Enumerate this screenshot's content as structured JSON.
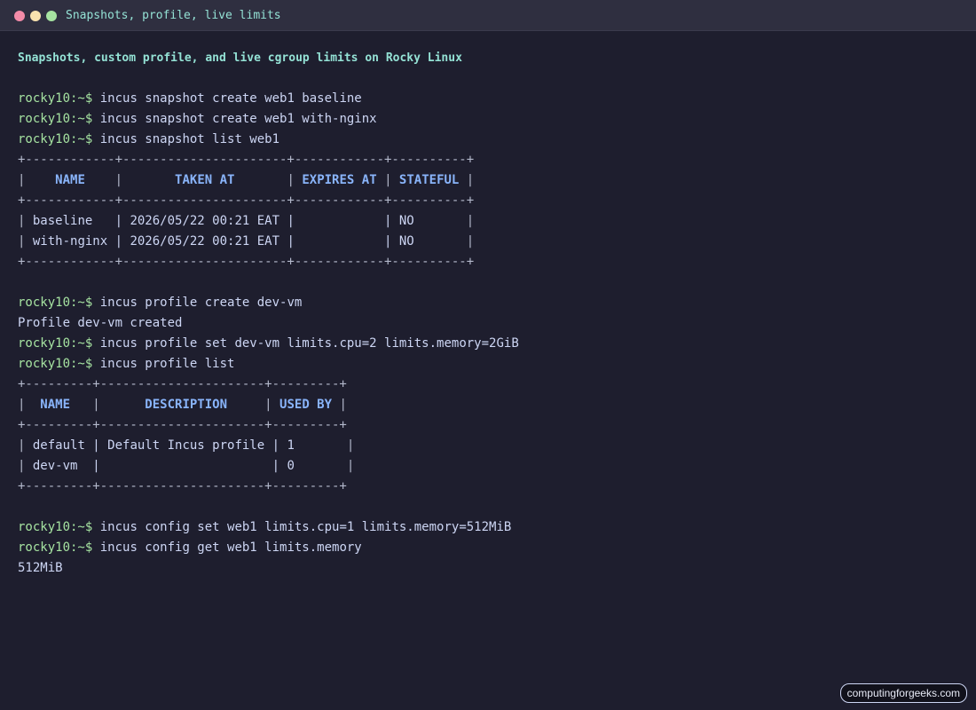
{
  "window": {
    "title": "Snapshots, profile, live limits"
  },
  "colors": {
    "background": "#1e1e2e",
    "titlebar": "#2f2f40",
    "prompt": "#a6e3a1",
    "heading": "#94e2d5",
    "table_header": "#89b4fa",
    "text": "#cdd6f4",
    "close_dot": "#f38ba8",
    "minimize_dot": "#f9e2af",
    "maximize_dot": "#a6e3a1"
  },
  "terminal": {
    "heading": "Snapshots, custom profile, and live cgroup limits on Rocky Linux",
    "prompt": "rocky10:~$",
    "commands": {
      "snap_create_1": "incus snapshot create web1 baseline",
      "snap_create_2": "incus snapshot create web1 with-nginx",
      "snap_list": "incus snapshot list web1",
      "profile_create": "incus profile create dev-vm",
      "profile_set": "incus profile set dev-vm limits.cpu=2 limits.memory=2GiB",
      "profile_list": "incus profile list",
      "config_set": "incus config set web1 limits.cpu=1 limits.memory=512MiB",
      "config_get": "incus config get web1 limits.memory"
    },
    "outputs": {
      "profile_created": "Profile dev-vm created",
      "memory_value": "512MiB"
    },
    "snapshot_table": {
      "border": "+------------+----------------------+------------+----------+",
      "headers": [
        "NAME",
        "TAKEN AT",
        "EXPIRES AT",
        "STATEFUL"
      ],
      "header_cells": [
        "    NAME    ",
        "       TAKEN AT       ",
        " EXPIRES AT ",
        " STATEFUL "
      ],
      "rows": [
        " baseline   | 2026/05/22 00:21 EAT |            | NO       ",
        " with-nginx | 2026/05/22 00:21 EAT |            | NO       "
      ]
    },
    "profile_table": {
      "border": "+---------+----------------------+---------+",
      "headers": [
        "NAME",
        "DESCRIPTION",
        "USED BY"
      ],
      "header_cells": [
        "  NAME   ",
        "      DESCRIPTION     ",
        " USED BY "
      ],
      "rows": [
        " default | Default Incus profile | 1       ",
        " dev-vm  |                       | 0       "
      ]
    }
  },
  "watermark": "computingforgeeks.com"
}
